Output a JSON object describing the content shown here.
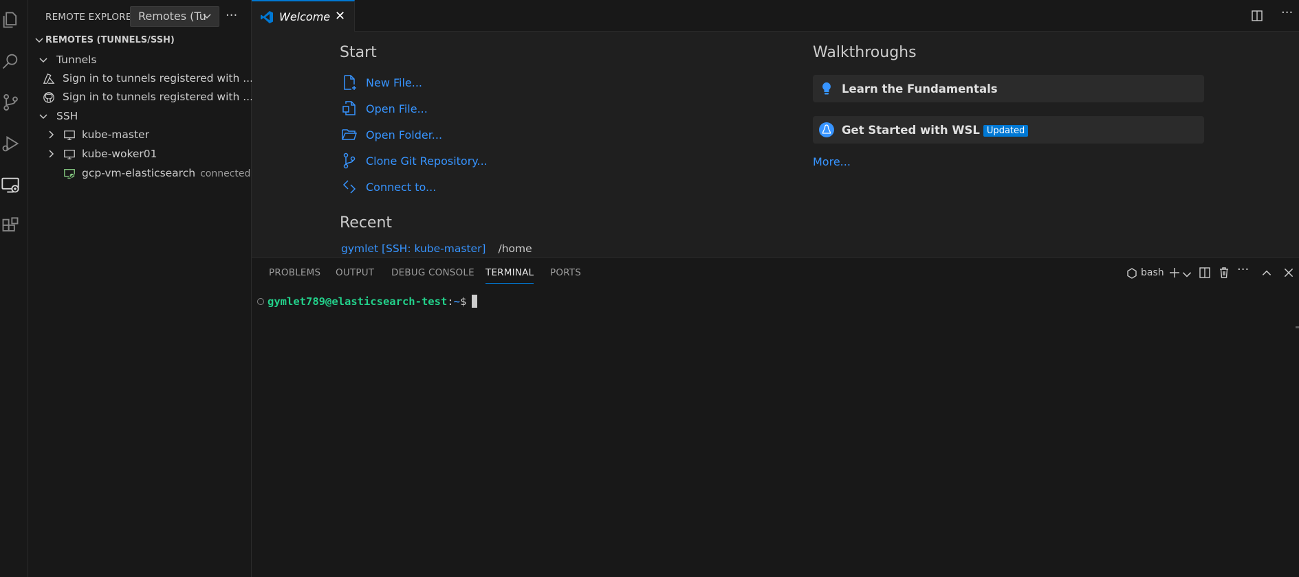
{
  "sidebar": {
    "title": "REMOTE EXPLORER",
    "dropdown_value": "Remotes (Tu",
    "more": "···",
    "section_title": "REMOTES (TUNNELS/SSH)",
    "tunnels_label": "Tunnels",
    "tunnel_items": [
      {
        "label": "Sign in to tunnels registered with ...",
        "icon": "azure-icon"
      },
      {
        "label": "Sign in to tunnels registered with ...",
        "icon": "github-icon"
      }
    ],
    "ssh_label": "SSH",
    "ssh_hosts": [
      {
        "label": "kube-master",
        "icon": "monitor-icon",
        "description": ""
      },
      {
        "label": "kube-woker01",
        "icon": "monitor-icon",
        "description": ""
      },
      {
        "label": "gcp-vm-elasticsearch",
        "icon": "connected-monitor-icon",
        "description": "connected"
      }
    ]
  },
  "editor": {
    "tab_label": "Welcome",
    "tab_close": "✕",
    "more": "···",
    "welcome": {
      "start_heading": "Start",
      "start_items": [
        {
          "label": "New File...",
          "icon": "new-file-icon"
        },
        {
          "label": "Open File...",
          "icon": "open-file-icon"
        },
        {
          "label": "Open Folder...",
          "icon": "open-folder-icon"
        },
        {
          "label": "Clone Git Repository...",
          "icon": "git-branch-icon"
        },
        {
          "label": "Connect to...",
          "icon": "remote-connect-icon"
        }
      ],
      "recent_heading": "Recent",
      "recent_items": [
        {
          "label": "gymlet [SSH: kube-master]",
          "path": "/home"
        }
      ],
      "walkthroughs_heading": "Walkthroughs",
      "walkthroughs": [
        {
          "label": "Learn the Fundamentals",
          "icon": "lightbulb-icon",
          "badge": ""
        },
        {
          "label": "Get Started with WSL",
          "icon": "linux-icon",
          "badge": "Updated"
        }
      ],
      "more_link": "More..."
    }
  },
  "panel": {
    "tabs": [
      "PROBLEMS",
      "OUTPUT",
      "DEBUG CONSOLE",
      "TERMINAL",
      "PORTS"
    ],
    "active_tab": "TERMINAL",
    "terminal_name": "bash",
    "more": "···",
    "terminal": {
      "user_host": "gymlet789@elasticsearch-test",
      "colon": ":",
      "path": "~",
      "symbol": "$"
    }
  },
  "colors": {
    "accent": "#0078d4",
    "link": "#3794ff",
    "prompt_green": "#23d18b",
    "connected_green": "#89d185"
  }
}
